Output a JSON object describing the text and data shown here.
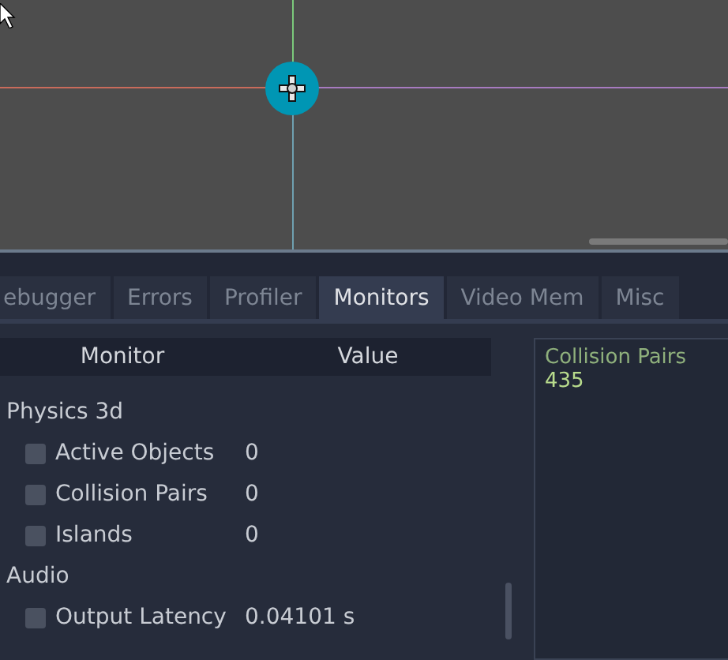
{
  "tabs": [
    {
      "label": "ebugger",
      "selected": false
    },
    {
      "label": "Errors",
      "selected": false
    },
    {
      "label": "Profiler",
      "selected": false
    },
    {
      "label": "Monitors",
      "selected": true
    },
    {
      "label": "Video Mem",
      "selected": false
    },
    {
      "label": "Misc",
      "selected": false
    }
  ],
  "monitor_table": {
    "columns": [
      "Monitor",
      "Value"
    ],
    "groups": [
      {
        "label": "Physics 3d",
        "children": [
          {
            "label": "Active Objects",
            "value": "0",
            "checked": false
          },
          {
            "label": "Collision Pairs",
            "value": "0",
            "checked": false
          },
          {
            "label": "Islands",
            "value": "0",
            "checked": false
          }
        ]
      },
      {
        "label": "Audio",
        "children": [
          {
            "label": "Output Latency",
            "value": "0.04101 s",
            "checked": false
          }
        ]
      }
    ]
  },
  "graph": {
    "title": "Collision Pairs",
    "value": "435"
  }
}
